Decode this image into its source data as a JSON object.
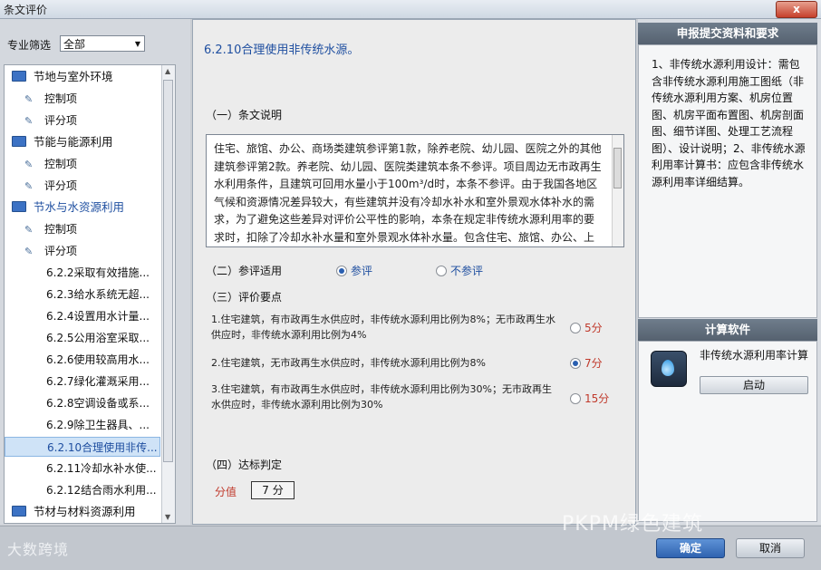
{
  "window": {
    "title": "条文评价",
    "close_label": "x"
  },
  "filter": {
    "label": "专业筛选",
    "value": "全部"
  },
  "tree": {
    "items": [
      {
        "type": "cat",
        "label": "节地与室外环境"
      },
      {
        "type": "sub",
        "label": "控制项"
      },
      {
        "type": "sub",
        "label": "评分项"
      },
      {
        "type": "cat",
        "label": "节能与能源利用"
      },
      {
        "type": "sub",
        "label": "控制项"
      },
      {
        "type": "sub",
        "label": "评分项"
      },
      {
        "type": "cat",
        "label": "节水与水资源利用"
      },
      {
        "type": "sub",
        "label": "控制项"
      },
      {
        "type": "sub",
        "label": "评分项"
      },
      {
        "type": "leaf",
        "label": "6.2.2采取有效措施..."
      },
      {
        "type": "leaf",
        "label": "6.2.3给水系统无超..."
      },
      {
        "type": "leaf",
        "label": "6.2.4设置用水计量..."
      },
      {
        "type": "leaf",
        "label": "6.2.5公用浴室采取..."
      },
      {
        "type": "leaf",
        "label": "6.2.6使用较高用水..."
      },
      {
        "type": "leaf",
        "label": "6.2.7绿化灌溉采用..."
      },
      {
        "type": "leaf",
        "label": "6.2.8空调设备或系..."
      },
      {
        "type": "leaf",
        "label": "6.2.9除卫生器具、..."
      },
      {
        "type": "leaf",
        "label": "6.2.10合理使用非传..."
      },
      {
        "type": "leaf",
        "label": "6.2.11冷却水补水使..."
      },
      {
        "type": "leaf",
        "label": "6.2.12结合雨水利用..."
      },
      {
        "type": "cat",
        "label": "节材与材料资源利用"
      }
    ]
  },
  "clause": {
    "title": "6.2.10合理使用非传统水源。",
    "explain_heading": "（一）条文说明",
    "explain_text": "住宅、旅馆、办公、商场类建筑参评第1款，除养老院、幼儿园、医院之外的其他建筑参评第2款。养老院、幼儿园、医院类建筑本条不参评。项目周边无市政再生水利用条件，且建筑可回用水量小于100m³/d时，本条不参评。由于我国各地区气候和资源情况差异较大，有些建筑并没有冷却水补水和室外景观水体补水的需求，为了避免这些差异对评价公平性的影响，本条在规定非传统水源利用率的要求时，扣除了冷却水补水量和室外景观水体补水量。包含住宅、旅馆、办公、上次等不同功能区域的综合性建筑，各功能区",
    "applicable_heading": "（二）参评适用",
    "applicable_yes": "参评",
    "applicable_no": "不参评",
    "points_heading": "（三）评价要点",
    "criteria": [
      {
        "text": "1.住宅建筑，有市政再生水供应时，非传统水源利用比例为8%；无市政再生水供应时，非传统水源利用比例为4%",
        "score": "5分"
      },
      {
        "text": "2.住宅建筑，无市政再生水供应时，非传统水源利用比例为8%",
        "score": "7分"
      },
      {
        "text": "3.住宅建筑，有市政再生水供应时，非传统水源利用比例为30%；无市政再生水供应时，非传统水源利用比例为30%",
        "score": "15分"
      }
    ],
    "judge_heading": "（四）达标判定",
    "score_label": "分值",
    "score_value": "7 分"
  },
  "right": {
    "req_heading": "申报提交资料和要求",
    "req_text": "1、非传统水源利用设计：需包含非传统水源利用施工图纸（非传统水源利用方案、机房位置图、机房平面布置图、机房剖面图、细节详图、处理工艺流程图）、设计说明；2、非传统水源利用率计算书：应包含非传统水源利用率详细结算。",
    "calc_heading": "计算软件",
    "app_name": "非传统水源利用率计算",
    "start_label": "启动"
  },
  "footer": {
    "ok_label": "确定",
    "cancel_label": "取消"
  },
  "watermarks": {
    "left": "大数跨境",
    "right": "PKPM绿色建筑"
  }
}
